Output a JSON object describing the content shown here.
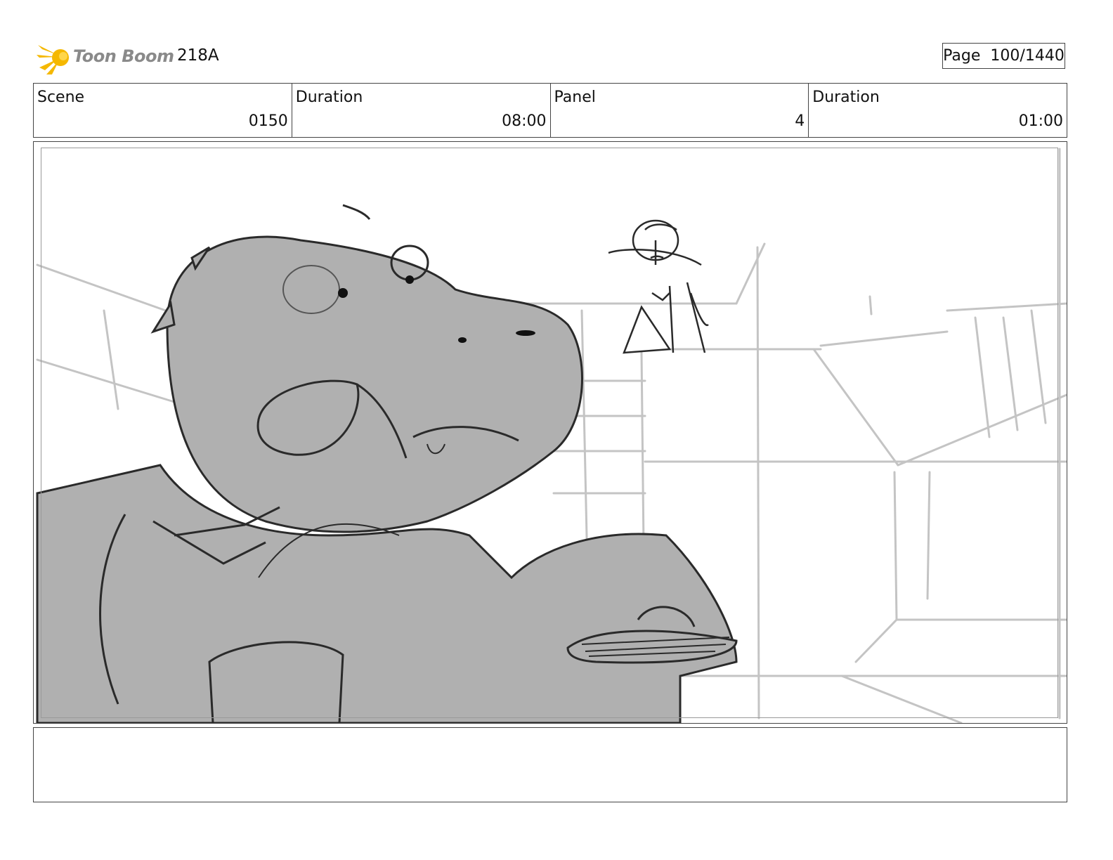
{
  "header": {
    "logo_text": "Toon Boom",
    "episode": "218A",
    "page_label": "Page",
    "page_value": "100/1440"
  },
  "info": {
    "scene_label": "Scene",
    "scene_value": "0150",
    "scene_duration_label": "Duration",
    "scene_duration_value": "08:00",
    "panel_label": "Panel",
    "panel_value": "4",
    "panel_duration_label": "Duration",
    "panel_duration_value": "01:00"
  },
  "notes": {
    "text": ""
  },
  "colors": {
    "logo_flame": "#f5b800",
    "logo_text": "#8a8a8a",
    "sketch_fill": "#b0b0b0",
    "sketch_line": "#2a2a2a",
    "background_line": "#c4c4c4"
  },
  "icons": {
    "logo": "toon-boom-flame-icon"
  }
}
